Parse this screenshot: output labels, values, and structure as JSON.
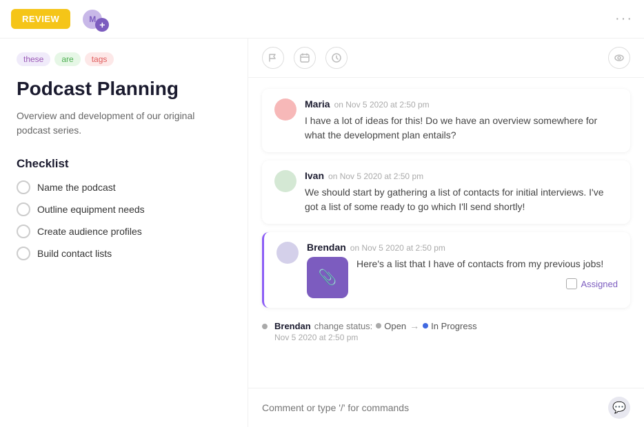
{
  "topbar": {
    "review_label": "REVIEW",
    "dots": "···",
    "avatar_initials": "M"
  },
  "left": {
    "tags": [
      {
        "label": "these",
        "type": "purple"
      },
      {
        "label": "are",
        "type": "green"
      },
      {
        "label": "tags",
        "type": "red"
      }
    ],
    "title": "Podcast Planning",
    "description": "Overview and development of our original podcast series.",
    "checklist_title": "Checklist",
    "checklist_items": [
      {
        "label": "Name the podcast"
      },
      {
        "label": "Outline equipment needs"
      },
      {
        "label": "Create audience profiles"
      },
      {
        "label": "Build contact lists"
      }
    ]
  },
  "right": {
    "toolbar_icons": [
      "flag",
      "calendar",
      "clock",
      "eye"
    ],
    "comments": [
      {
        "id": "maria",
        "author": "Maria",
        "time": "on Nov 5 2020 at 2:50 pm",
        "text": "I have a lot of ideas for this! Do we have an overview somewhere for what the development plan entails?",
        "has_attachment": false
      },
      {
        "id": "ivan",
        "author": "Ivan",
        "time": "on Nov 5 2020 at 2:50 pm",
        "text": "We should start by gathering a list of contacts for initial interviews. I've got a list of some ready to go which I'll send shortly!",
        "has_attachment": false
      },
      {
        "id": "brendan",
        "author": "Brendan",
        "time": "on Nov 5 2020 at 2:50 pm",
        "text": "Here's a list that I have of contacts from my previous jobs!",
        "has_attachment": true,
        "assigned_label": "Assigned"
      }
    ],
    "status_change": {
      "author": "Brendan",
      "action": "change status:",
      "from": "Open",
      "to": "In Progress",
      "timestamp": "Nov 5 2020 at 2:50 pm"
    },
    "comment_placeholder": "Comment or type '/' for commands"
  }
}
